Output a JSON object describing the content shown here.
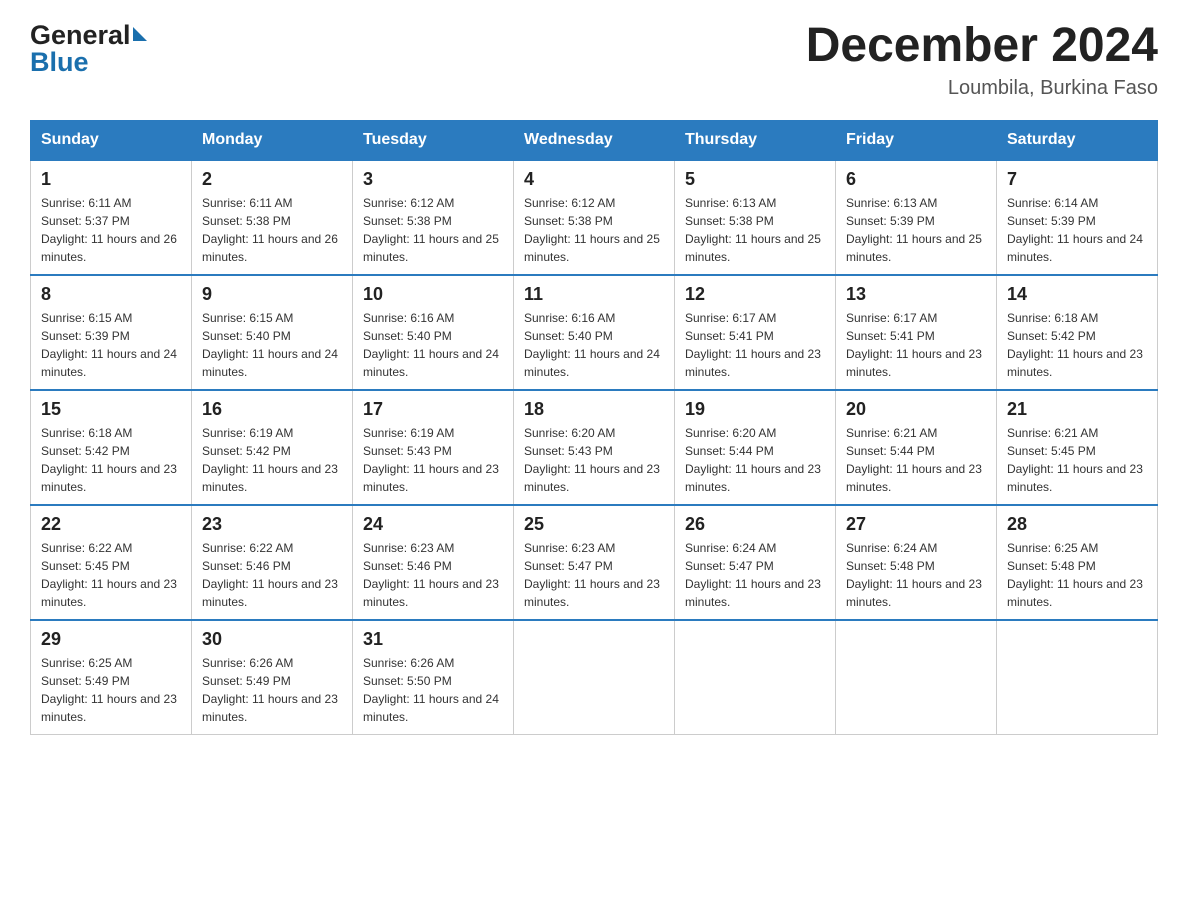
{
  "logo": {
    "general": "General",
    "blue": "Blue"
  },
  "title": "December 2024",
  "subtitle": "Loumbila, Burkina Faso",
  "days_of_week": [
    "Sunday",
    "Monday",
    "Tuesday",
    "Wednesday",
    "Thursday",
    "Friday",
    "Saturday"
  ],
  "weeks": [
    [
      {
        "day": "1",
        "sunrise": "6:11 AM",
        "sunset": "5:37 PM",
        "daylight": "11 hours and 26 minutes."
      },
      {
        "day": "2",
        "sunrise": "6:11 AM",
        "sunset": "5:38 PM",
        "daylight": "11 hours and 26 minutes."
      },
      {
        "day": "3",
        "sunrise": "6:12 AM",
        "sunset": "5:38 PM",
        "daylight": "11 hours and 25 minutes."
      },
      {
        "day": "4",
        "sunrise": "6:12 AM",
        "sunset": "5:38 PM",
        "daylight": "11 hours and 25 minutes."
      },
      {
        "day": "5",
        "sunrise": "6:13 AM",
        "sunset": "5:38 PM",
        "daylight": "11 hours and 25 minutes."
      },
      {
        "day": "6",
        "sunrise": "6:13 AM",
        "sunset": "5:39 PM",
        "daylight": "11 hours and 25 minutes."
      },
      {
        "day": "7",
        "sunrise": "6:14 AM",
        "sunset": "5:39 PM",
        "daylight": "11 hours and 24 minutes."
      }
    ],
    [
      {
        "day": "8",
        "sunrise": "6:15 AM",
        "sunset": "5:39 PM",
        "daylight": "11 hours and 24 minutes."
      },
      {
        "day": "9",
        "sunrise": "6:15 AM",
        "sunset": "5:40 PM",
        "daylight": "11 hours and 24 minutes."
      },
      {
        "day": "10",
        "sunrise": "6:16 AM",
        "sunset": "5:40 PM",
        "daylight": "11 hours and 24 minutes."
      },
      {
        "day": "11",
        "sunrise": "6:16 AM",
        "sunset": "5:40 PM",
        "daylight": "11 hours and 24 minutes."
      },
      {
        "day": "12",
        "sunrise": "6:17 AM",
        "sunset": "5:41 PM",
        "daylight": "11 hours and 23 minutes."
      },
      {
        "day": "13",
        "sunrise": "6:17 AM",
        "sunset": "5:41 PM",
        "daylight": "11 hours and 23 minutes."
      },
      {
        "day": "14",
        "sunrise": "6:18 AM",
        "sunset": "5:42 PM",
        "daylight": "11 hours and 23 minutes."
      }
    ],
    [
      {
        "day": "15",
        "sunrise": "6:18 AM",
        "sunset": "5:42 PM",
        "daylight": "11 hours and 23 minutes."
      },
      {
        "day": "16",
        "sunrise": "6:19 AM",
        "sunset": "5:42 PM",
        "daylight": "11 hours and 23 minutes."
      },
      {
        "day": "17",
        "sunrise": "6:19 AM",
        "sunset": "5:43 PM",
        "daylight": "11 hours and 23 minutes."
      },
      {
        "day": "18",
        "sunrise": "6:20 AM",
        "sunset": "5:43 PM",
        "daylight": "11 hours and 23 minutes."
      },
      {
        "day": "19",
        "sunrise": "6:20 AM",
        "sunset": "5:44 PM",
        "daylight": "11 hours and 23 minutes."
      },
      {
        "day": "20",
        "sunrise": "6:21 AM",
        "sunset": "5:44 PM",
        "daylight": "11 hours and 23 minutes."
      },
      {
        "day": "21",
        "sunrise": "6:21 AM",
        "sunset": "5:45 PM",
        "daylight": "11 hours and 23 minutes."
      }
    ],
    [
      {
        "day": "22",
        "sunrise": "6:22 AM",
        "sunset": "5:45 PM",
        "daylight": "11 hours and 23 minutes."
      },
      {
        "day": "23",
        "sunrise": "6:22 AM",
        "sunset": "5:46 PM",
        "daylight": "11 hours and 23 minutes."
      },
      {
        "day": "24",
        "sunrise": "6:23 AM",
        "sunset": "5:46 PM",
        "daylight": "11 hours and 23 minutes."
      },
      {
        "day": "25",
        "sunrise": "6:23 AM",
        "sunset": "5:47 PM",
        "daylight": "11 hours and 23 minutes."
      },
      {
        "day": "26",
        "sunrise": "6:24 AM",
        "sunset": "5:47 PM",
        "daylight": "11 hours and 23 minutes."
      },
      {
        "day": "27",
        "sunrise": "6:24 AM",
        "sunset": "5:48 PM",
        "daylight": "11 hours and 23 minutes."
      },
      {
        "day": "28",
        "sunrise": "6:25 AM",
        "sunset": "5:48 PM",
        "daylight": "11 hours and 23 minutes."
      }
    ],
    [
      {
        "day": "29",
        "sunrise": "6:25 AM",
        "sunset": "5:49 PM",
        "daylight": "11 hours and 23 minutes."
      },
      {
        "day": "30",
        "sunrise": "6:26 AM",
        "sunset": "5:49 PM",
        "daylight": "11 hours and 23 minutes."
      },
      {
        "day": "31",
        "sunrise": "6:26 AM",
        "sunset": "5:50 PM",
        "daylight": "11 hours and 24 minutes."
      },
      null,
      null,
      null,
      null
    ]
  ]
}
